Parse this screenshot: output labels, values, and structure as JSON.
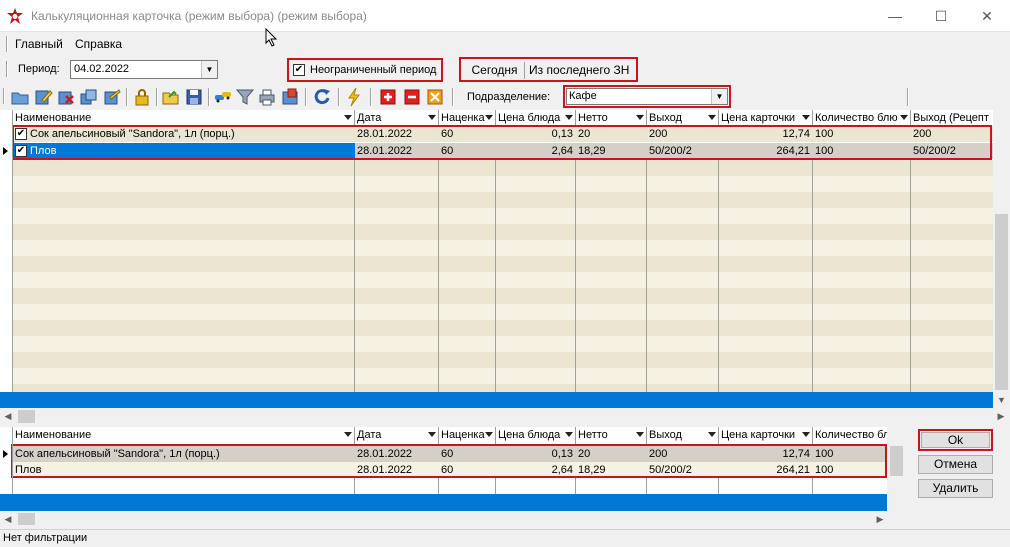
{
  "window": {
    "title": "Калькуляционная карточка (режим выбора) (режим выбора)",
    "minimize": "—",
    "maximize": "☐",
    "close": "✕"
  },
  "menu": {
    "items": [
      "Главный",
      "Справка"
    ]
  },
  "period": {
    "label": "Период:",
    "date": "04.02.2022",
    "unlimited_label": "Неограниченный период",
    "unlimited_checked": true,
    "today_button": "Сегодня",
    "last_button": "Из последнего ЗН"
  },
  "toolbar": {
    "subdivision_label": "Подразделение:",
    "subdivision_value": "Кафе",
    "icons": [
      "folder-icon",
      "edit-icon",
      "delete-icon",
      "copy-icon",
      "edit-note-icon",
      "lock-icon",
      "open-folder-icon",
      "save-icon",
      "cars-icon",
      "filter-icon",
      "print-icon",
      "export-icon",
      "refresh-icon",
      "lightning-icon",
      "add-icon",
      "remove-icon",
      "clear-icon"
    ]
  },
  "top_grid": {
    "columns": [
      "Наименование",
      "Дата",
      "Наценка",
      "Цена блюда",
      "Нетто",
      "Выход",
      "Цена карточки",
      "Количество блю",
      "Выход (Рецепт"
    ],
    "rows": [
      {
        "checked": true,
        "name": "Сок апельсиновый \"Sandora\", 1л (порц.)",
        "date": "28.01.2022",
        "markup": "60",
        "price": "0,13",
        "netto": "20",
        "out": "200",
        "card_price": "12,74",
        "qty": "100",
        "out_recipe": "200"
      },
      {
        "checked": true,
        "name": "Плов",
        "date": "28.01.2022",
        "markup": "60",
        "price": "2,64",
        "netto": "18,29",
        "out": "50/200/2",
        "card_price": "264,21",
        "qty": "100",
        "out_recipe": "50/200/2"
      }
    ]
  },
  "bottom_grid": {
    "columns": [
      "Наименование",
      "Дата",
      "Наценка",
      "Цена блюда",
      "Нетто",
      "Выход",
      "Цена карточки",
      "Количество бл"
    ],
    "rows": [
      {
        "name": "Сок апельсиновый \"Sandora\", 1л (порц.)",
        "date": "28.01.2022",
        "markup": "60",
        "price": "0,13",
        "netto": "20",
        "out": "200",
        "card_price": "12,74",
        "qty": "100"
      },
      {
        "name": "Плов",
        "date": "28.01.2022",
        "markup": "60",
        "price": "2,64",
        "netto": "18,29",
        "out": "50/200/2",
        "card_price": "264,21",
        "qty": "100"
      }
    ]
  },
  "buttons": {
    "ok": "Ok",
    "cancel": "Отмена",
    "delete": "Удалить"
  },
  "status": "Нет фильтрации",
  "colors": {
    "accent": "#0078d7",
    "highlight": "#c8141e",
    "stripe_a": "#f5f1e3",
    "stripe_b": "#ebe6d1",
    "selected_row": "#d4d0c8"
  }
}
